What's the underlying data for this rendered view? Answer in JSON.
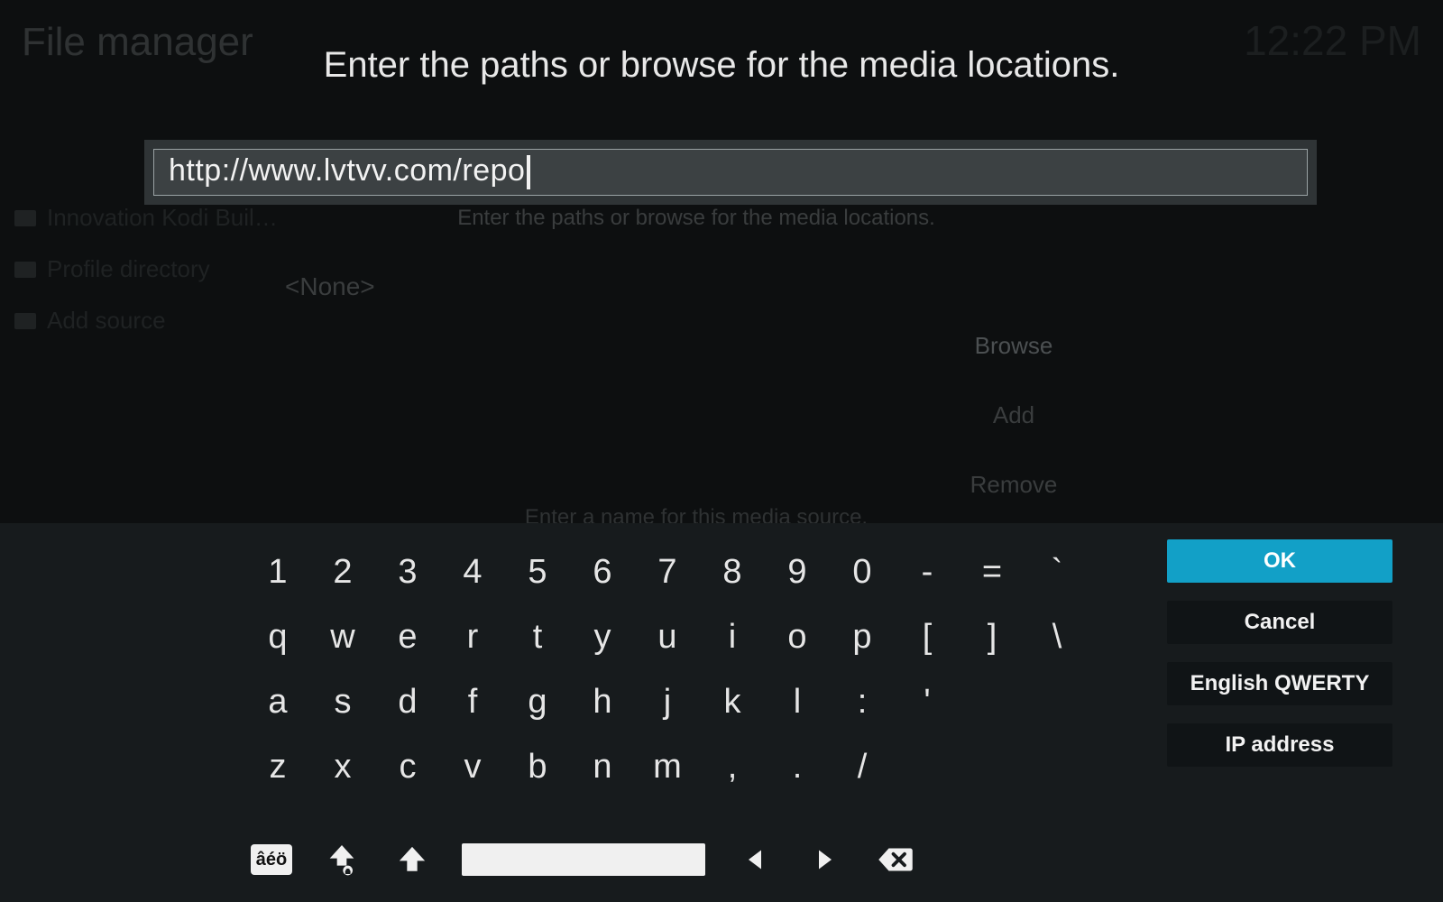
{
  "background": {
    "title": "File manager",
    "clock": "12:22 PM",
    "sidebar_items": [
      "Innovation Kodi Buil…",
      "Profile directory",
      "Add source"
    ],
    "panel_hint": "Enter the paths or browse for the media locations.",
    "none_label": "<None>",
    "buttons": {
      "browse": "Browse",
      "add": "Add",
      "remove": "Remove"
    },
    "name_hint": "Enter a name for this media source."
  },
  "modal": {
    "title": "Enter the paths or browse for the media locations.",
    "input_value": "http://www.lvtvv.com/repo"
  },
  "keyboard": {
    "rows": [
      [
        "1",
        "2",
        "3",
        "4",
        "5",
        "6",
        "7",
        "8",
        "9",
        "0",
        "-",
        "=",
        "`"
      ],
      [
        "q",
        "w",
        "e",
        "r",
        "t",
        "y",
        "u",
        "i",
        "o",
        "p",
        "[",
        "]",
        "\\"
      ],
      [
        "a",
        "s",
        "d",
        "f",
        "g",
        "h",
        "j",
        "k",
        "l",
        ":",
        "'"
      ],
      [
        "z",
        "x",
        "c",
        "v",
        "b",
        "n",
        "m",
        ",",
        ".",
        "/"
      ]
    ],
    "side_buttons": {
      "ok": "OK",
      "cancel": "Cancel",
      "layout": "English QWERTY",
      "ip": "IP address"
    },
    "accent_label": "âéö"
  }
}
